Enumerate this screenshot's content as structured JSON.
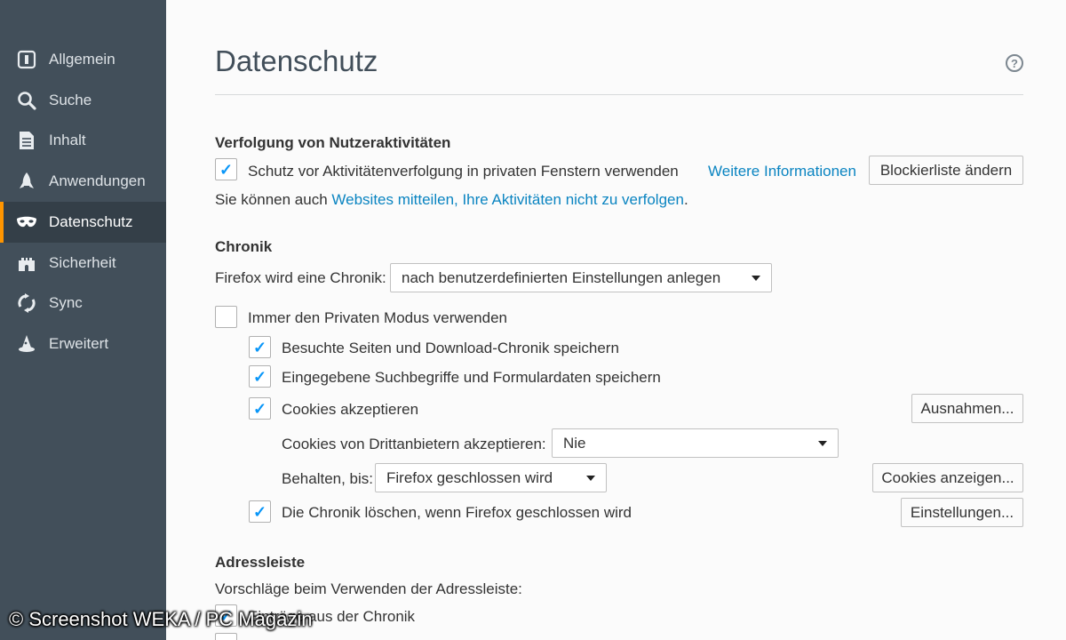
{
  "sidebar": {
    "items": [
      {
        "label": "Allgemein",
        "icon": "general-icon"
      },
      {
        "label": "Suche",
        "icon": "search-icon"
      },
      {
        "label": "Inhalt",
        "icon": "document-icon"
      },
      {
        "label": "Anwendungen",
        "icon": "rocket-icon"
      },
      {
        "label": "Datenschutz",
        "icon": "mask-icon",
        "active": true
      },
      {
        "label": "Sicherheit",
        "icon": "castle-icon"
      },
      {
        "label": "Sync",
        "icon": "sync-icon"
      },
      {
        "label": "Erweitert",
        "icon": "wizard-hat-icon"
      }
    ]
  },
  "header": {
    "title": "Datenschutz",
    "help_icon": "?"
  },
  "tracking": {
    "heading": "Verfolgung von Nutzeraktivitäten",
    "protect_label": "Schutz vor Aktivitätenverfolgung in privaten Fenstern verwenden",
    "protect_checked": true,
    "more_info_link": "Weitere Informationen",
    "blocklist_button": "Blockierliste ändern",
    "dnt_prefix": "Sie können auch ",
    "dnt_link": "Websites mitteilen, Ihre Aktivitäten nicht zu verfolgen",
    "dnt_suffix": "."
  },
  "history": {
    "heading": "Chronik",
    "mode_label": "Firefox wird eine Chronik:",
    "mode_value": "nach benutzerdefinierten Einstellungen anlegen",
    "private_mode_label": "Immer den Privaten Modus verwenden",
    "private_mode_checked": false,
    "visited_label": "Besuchte Seiten und Download-Chronik speichern",
    "visited_checked": true,
    "search_form_label": "Eingegebene Suchbegriffe und Formulardaten speichern",
    "search_form_checked": true,
    "cookies_label": "Cookies akzeptieren",
    "cookies_checked": true,
    "exceptions_button": "Ausnahmen...",
    "third_party_label": "Cookies von Drittanbietern akzeptieren:",
    "third_party_value": "Nie",
    "keep_until_label": "Behalten, bis:",
    "keep_until_value": "Firefox geschlossen wird",
    "show_cookies_button": "Cookies anzeigen...",
    "clear_on_close_label": "Die Chronik löschen, wenn Firefox geschlossen wird",
    "clear_on_close_checked": true,
    "settings_button": "Einstellungen..."
  },
  "addressbar": {
    "heading": "Adressleiste",
    "suggestions_label": "Vorschläge beim Verwenden der Adressleiste:",
    "history_label": "Einträge aus der Chronik",
    "history_checked": true
  },
  "watermark": "© Screenshot WEKA / PC Magazin",
  "colors": {
    "sidebar": "#424f5a",
    "active_indicator": "#ff9500",
    "link": "#0a84c1",
    "check": "#0996f8"
  }
}
